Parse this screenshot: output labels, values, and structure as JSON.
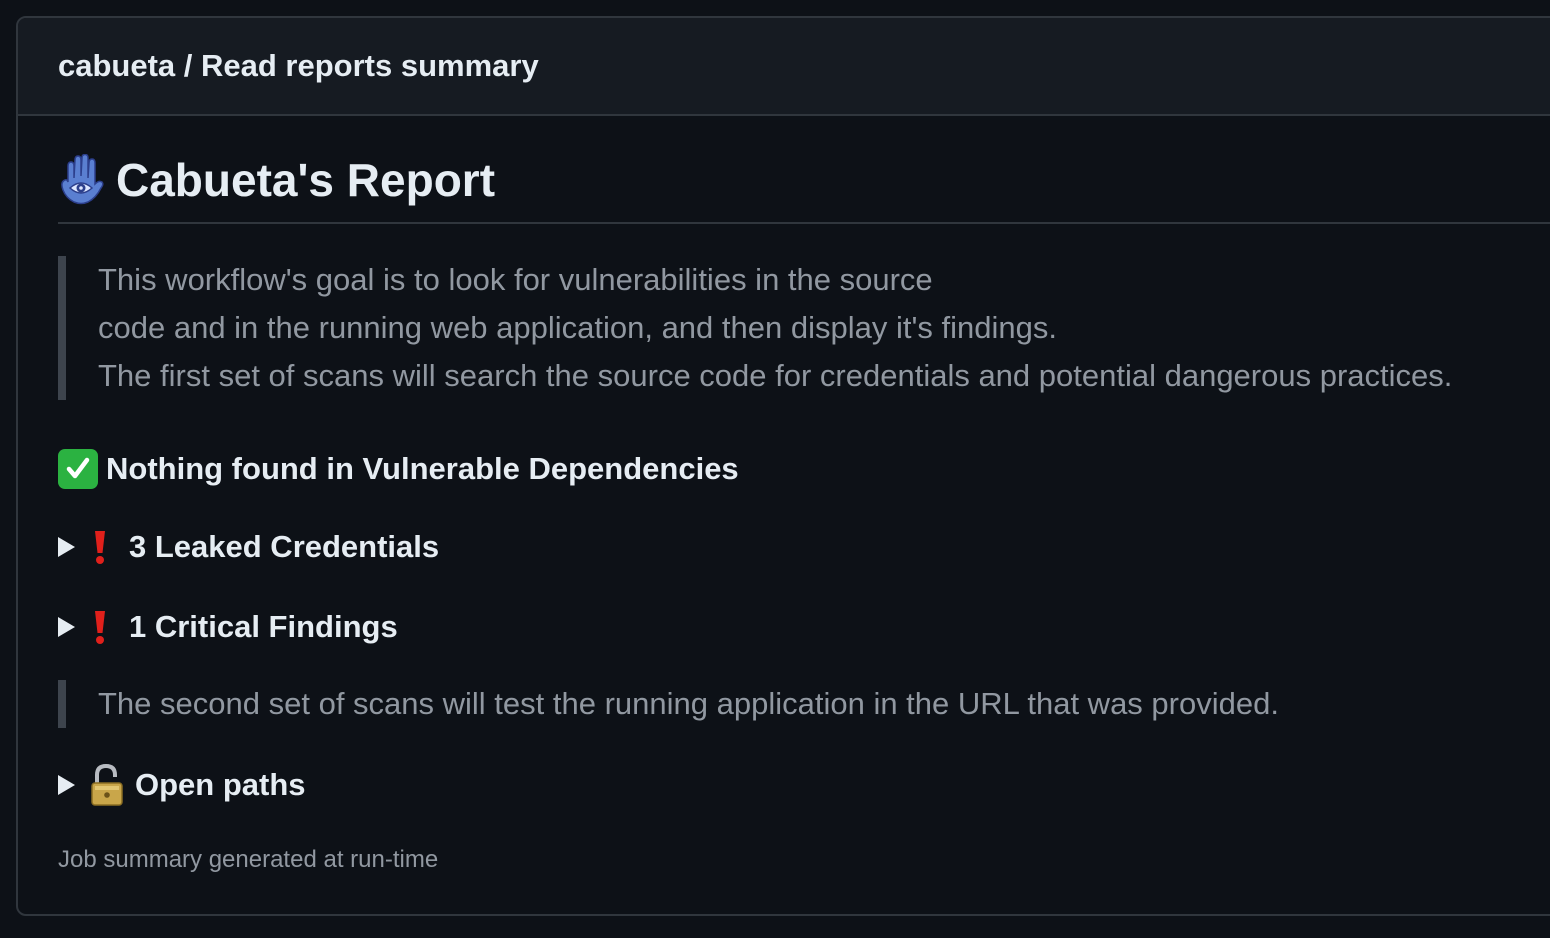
{
  "header": {
    "title": "cabueta / Read reports summary"
  },
  "report": {
    "title": "Cabueta's Report",
    "intro_lines": [
      "This workflow's goal is to look for vulnerabilities in the source",
      "code and in the running web application, and then display it's findings.",
      "The first set of scans will search the source code for credentials and potential dangerous practices."
    ],
    "dependencies_status": "Nothing found in Vulnerable Dependencies",
    "leaked_credentials": "3 Leaked Credentials",
    "critical_findings": "1 Critical Findings",
    "second_scan_note": "The second set of scans will test the running application in the URL that was provided.",
    "open_paths": "Open paths"
  },
  "footer": {
    "text": "Job summary generated at run-time"
  },
  "icons": {
    "title_icon": "hamsa-icon",
    "status_ok": "check-mark-button-icon",
    "status_alert": "exclamation-icon",
    "expander": "triangle-right-icon",
    "open_paths": "unlocked-padlock-icon"
  },
  "colors": {
    "background": "#0d1117",
    "header_bg": "#161b22",
    "border": "#30363d",
    "text": "#e6edf3",
    "muted": "#9198a1",
    "success": "#2bb241",
    "alert": "#e0201b"
  }
}
